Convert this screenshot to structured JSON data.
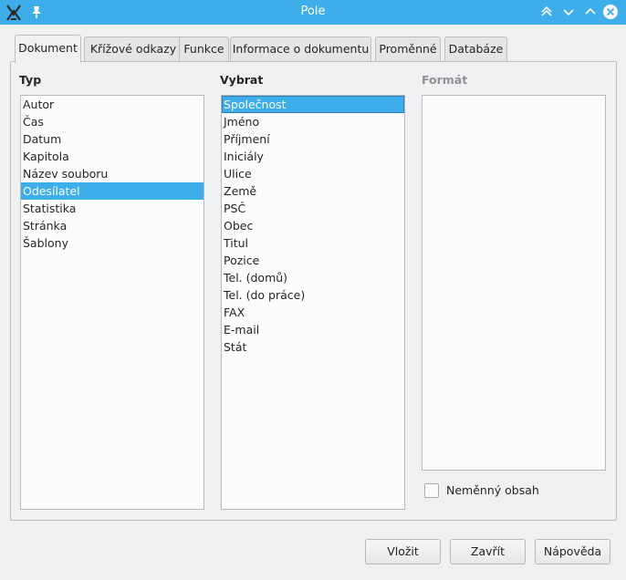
{
  "window": {
    "title": "Pole"
  },
  "tabs": [
    {
      "label": "Dokument"
    },
    {
      "label": "Křížové odkazy"
    },
    {
      "label": "Funkce"
    },
    {
      "label": "Informace o dokumentu"
    },
    {
      "label": "Proměnné"
    },
    {
      "label": "Databáze"
    }
  ],
  "columns": {
    "typ": {
      "label": "Typ",
      "items": [
        "Autor",
        "Čas",
        "Datum",
        "Kapitola",
        "Název souboru",
        "Odesílatel",
        "Statistika",
        "Stránka",
        "Šablony"
      ],
      "selected": "Odesílatel"
    },
    "vybrat": {
      "label": "Vybrat",
      "items": [
        "Společnost",
        "Jméno",
        "Příjmení",
        "Iniciály",
        "Ulice",
        "Země",
        "PSČ",
        "Obec",
        "Titul",
        "Pozice",
        "Tel. (domů)",
        "Tel. (do práce)",
        "FAX",
        "E-mail",
        "Stát"
      ],
      "selected": "Společnost"
    },
    "format": {
      "label": "Formát"
    }
  },
  "checkbox": {
    "label": "Neměnný obsah",
    "checked": false
  },
  "buttons": {
    "insert": "Vložit",
    "close": "Zavřít",
    "help": "Nápověda"
  },
  "colors": {
    "accent": "#3daee9",
    "window_bg": "#eff0f1",
    "list_bg": "#fcfcfc"
  }
}
